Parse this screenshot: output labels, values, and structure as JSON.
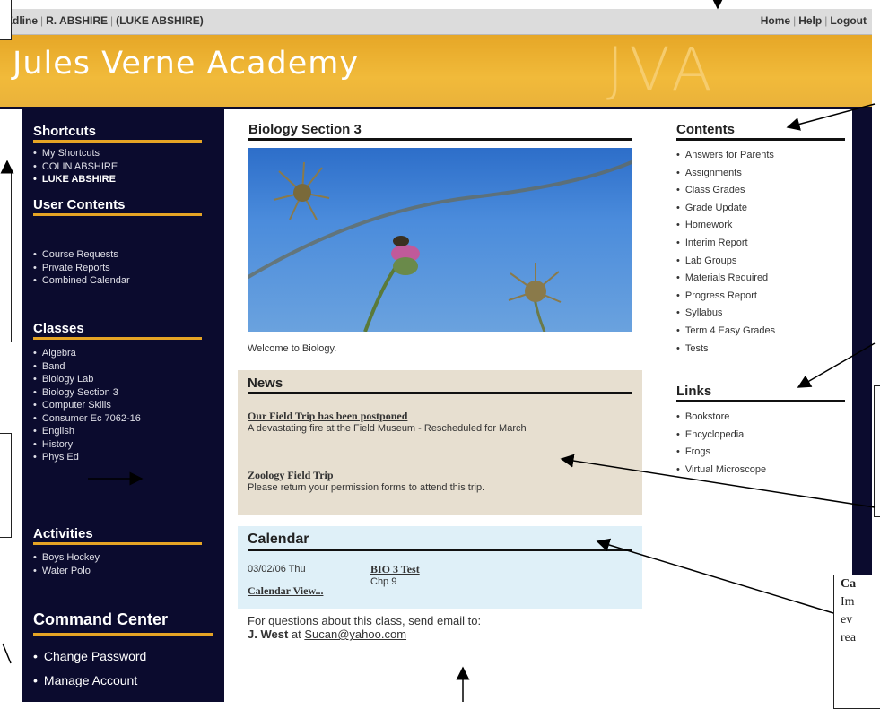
{
  "topbar": {
    "crumbs": [
      "Edline",
      "R. ABSHIRE",
      "(LUKE ABSHIRE)"
    ],
    "nav": [
      "Home",
      "Help",
      "Logout"
    ]
  },
  "banner": {
    "school_name": "Jules Verne Academy",
    "monogram": "JVA"
  },
  "sidebar": {
    "shortcuts": {
      "heading": "Shortcuts",
      "items": [
        "My Shortcuts",
        "COLIN ABSHIRE",
        "LUKE ABSHIRE"
      ]
    },
    "user_contents": {
      "heading": "User Contents",
      "items": [
        "Course Requests",
        "Private Reports",
        "Combined Calendar"
      ]
    },
    "classes": {
      "heading": "Classes",
      "items": [
        "Algebra",
        "Band",
        "Biology Lab",
        "Biology Section 3",
        "Computer Skills",
        "Consumer Ec 7062-16",
        "English",
        "History",
        "Phys Ed"
      ]
    },
    "activities": {
      "heading": "Activities",
      "items": [
        "Boys Hockey",
        "Water Polo"
      ]
    },
    "command_center": {
      "heading": "Command Center",
      "items": [
        "Change Password",
        "Manage Account"
      ]
    }
  },
  "main": {
    "title": "Biology Section 3",
    "welcome": "Welcome to Biology.",
    "news": {
      "heading": "News",
      "items": [
        {
          "title": "Our Field Trip has been postponed",
          "body": "A devastating fire at the Field Museum - Rescheduled for March"
        },
        {
          "title": "Zoology Field Trip",
          "body": "Please return your permission forms to attend this trip."
        }
      ]
    },
    "calendar": {
      "heading": "Calendar",
      "event": {
        "date": "03/02/06 Thu",
        "title": "BIO 3 Test",
        "note": "Chp 9"
      },
      "view_link": "Calendar View..."
    },
    "contact": {
      "line1": "For questions about this class, send email to:",
      "name": "J. West",
      "at": "at",
      "email": "Sucan@yahoo.com"
    }
  },
  "right": {
    "contents": {
      "heading": "Contents",
      "items": [
        "Answers for Parents",
        "Assignments",
        "Class Grades",
        "Grade Update",
        "Homework",
        "Interim Report",
        "Lab Groups",
        "Materials Required",
        "Progress Report",
        "Syllabus",
        "Term 4 Easy Grades",
        "Tests"
      ]
    },
    "links": {
      "heading": "Links",
      "items": [
        "Bookstore",
        "Encyclopedia",
        "Frogs",
        "Virtual Microscope"
      ]
    }
  },
  "annotation": {
    "callout_lines": [
      "Ca",
      "Im",
      "ev",
      "rea"
    ]
  },
  "colors": {
    "sidebar_bg": "#0b0b2e",
    "accent_gold": "#e5a425",
    "news_bg": "#e7dfd0",
    "calendar_bg": "#dff0f8"
  }
}
